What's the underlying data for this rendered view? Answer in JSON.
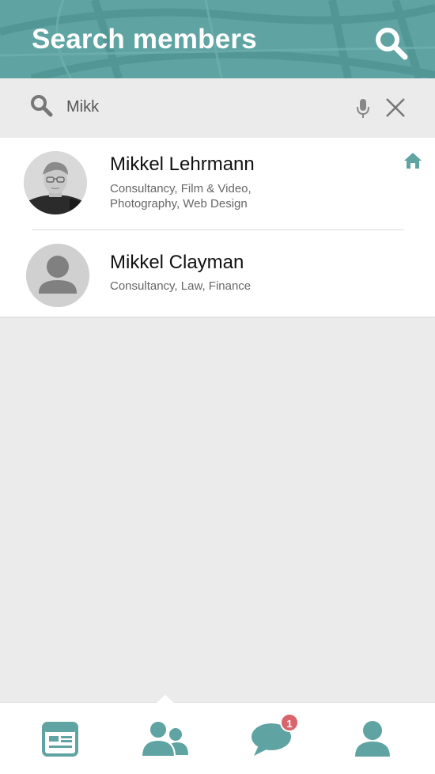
{
  "header": {
    "title": "Search members",
    "background_color": "#5fa4a2",
    "search_icon": "search-icon"
  },
  "search": {
    "value": "Mikk",
    "placeholder": "",
    "icons": [
      "search-icon",
      "microphone-icon",
      "close-icon"
    ]
  },
  "members": [
    {
      "name": "Mikkel Lehrmann",
      "tags": "Consultancy, Film & Video, Photography, Web Design",
      "avatar": "profile-photo",
      "badge_icon": "home-icon"
    },
    {
      "name": "Mikkel Clayman",
      "tags": "Consultancy, Law, Finance",
      "avatar": "default-avatar"
    }
  ],
  "tabbar": {
    "accent_color": "#5fa4a2",
    "tabs": [
      {
        "icon": "news-feed-icon"
      },
      {
        "icon": "members-icon",
        "active": true
      },
      {
        "icon": "messages-icon",
        "badge": "1"
      },
      {
        "icon": "profile-icon"
      }
    ],
    "badge_color": "#d9646b"
  }
}
